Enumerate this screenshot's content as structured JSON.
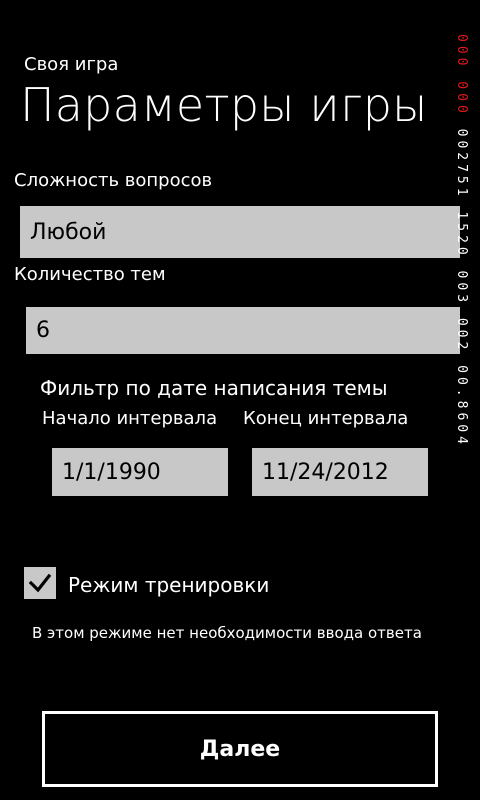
{
  "header": {
    "app_subtitle": "Своя игра",
    "title": "Параметры игры"
  },
  "difficulty": {
    "label": "Сложность вопросов",
    "value": "Любой"
  },
  "topics_count": {
    "label": "Количество тем",
    "value": "6"
  },
  "date_filter": {
    "title": "Фильтр по дате написания темы",
    "start_label": "Начало интервала",
    "start_value": "1/1/1990",
    "end_label": "Конец интервала",
    "end_value": "11/24/2012"
  },
  "training": {
    "checkbox_label": "Режим тренировки",
    "checked": true,
    "hint": "В этом режиме нет необходимости ввода ответа"
  },
  "next_button": {
    "label": "Далее"
  },
  "memory_counter": {
    "red_part": "000 000",
    "white_part": "002751 1520 003 002 00.8604"
  },
  "colors": {
    "background": "#000000",
    "field": "#c8c8c8",
    "text": "#ffffff",
    "counter_red": "#e01a1a"
  }
}
